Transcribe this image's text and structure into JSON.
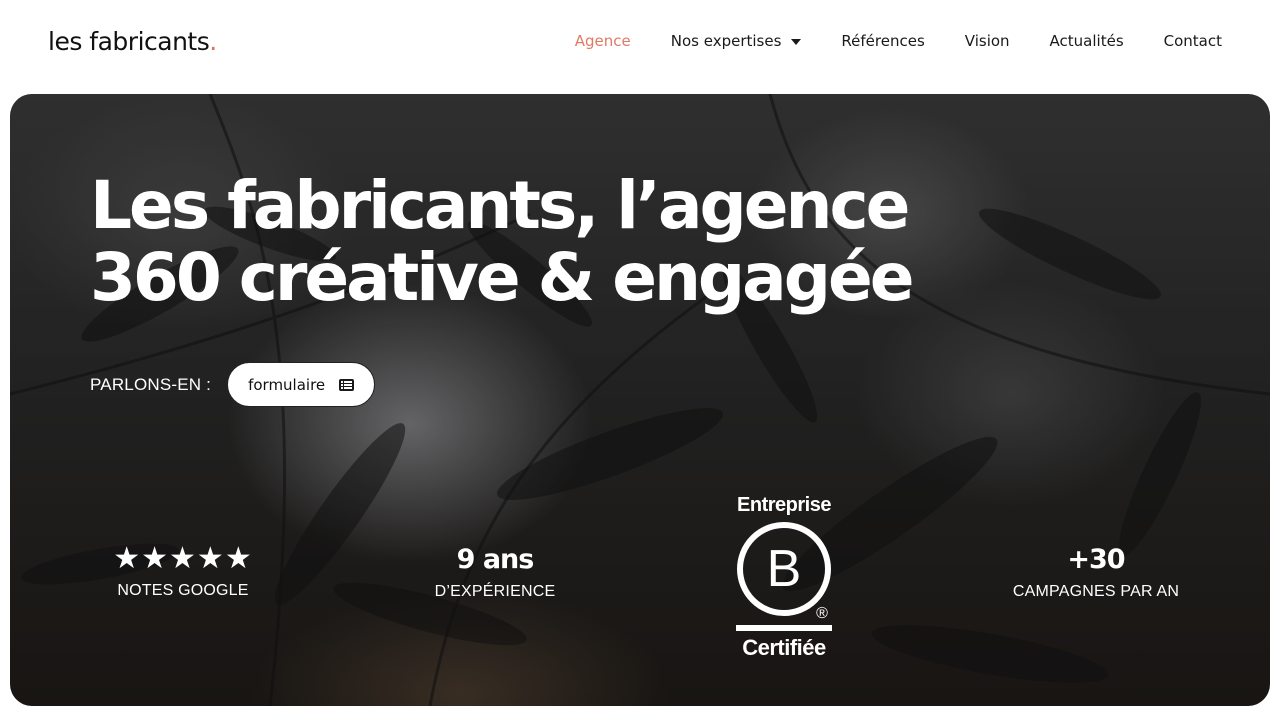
{
  "header": {
    "logo_text": "les fabricants",
    "logo_dot": ".",
    "nav": [
      {
        "label": "Agence",
        "active": true
      },
      {
        "label": "Nos expertises",
        "has_dropdown": true
      },
      {
        "label": "Références"
      },
      {
        "label": "Vision"
      },
      {
        "label": "Actualités"
      },
      {
        "label": "Contact"
      }
    ]
  },
  "hero": {
    "title_line1": "Les fabricants, l’agence",
    "title_line2": "360 créative & engagée",
    "cta_label": "PARLONS-EN :",
    "cta_button": "formulaire"
  },
  "stats": {
    "google": {
      "stars": "★★★★★",
      "rating_stars": 5,
      "label": "NOTES GOOGLE"
    },
    "experience": {
      "value": "9 ans",
      "label": "D’EXPÉRIENCE"
    },
    "bcorp": {
      "top": "Entreprise",
      "letter": "B",
      "registered": "®",
      "bottom": "Certifiée"
    },
    "campaigns": {
      "value": "+30",
      "label": "CAMPAGNES PAR AN"
    }
  },
  "colors": {
    "accent": "#e07a66",
    "logo_dot": "#e2704f",
    "text_dark": "#1a1a1a",
    "hero_text": "#ffffff"
  },
  "icons": {
    "dropdown": "chevron-down-icon",
    "form": "list-form-icon",
    "stars": "star-icon"
  }
}
